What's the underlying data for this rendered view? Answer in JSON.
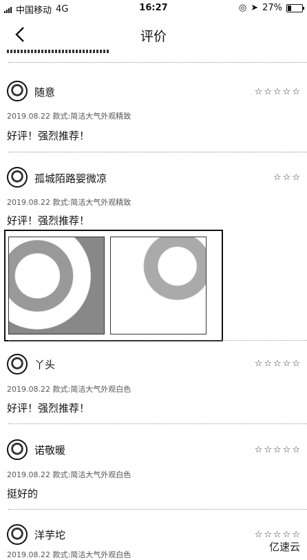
{
  "status_bar": {
    "carrier": "中国移动",
    "network": "4G",
    "time": "16:27",
    "battery_percent": "27%",
    "battery_level": 0.27
  },
  "nav": {
    "title": "评价",
    "back_icon": "chevron-left-icon"
  },
  "reviews": [
    {
      "name": "随意",
      "stars": "☆☆☆☆☆",
      "date": "2019.08.22",
      "variant": "款式:简洁大气外观精致",
      "text": "好评！强烈推荐！"
    },
    {
      "name": "孤城陌路婴微凉",
      "stars": "☆☆☆",
      "date": "2019.08.22",
      "variant": "款式:简洁大气外观精致",
      "text": "好评！强烈推荐！"
    },
    {
      "name": "丫头",
      "stars": "☆☆☆☆☆",
      "date": "2019.08.22",
      "variant": "款式:简洁大气外观白色",
      "text": "好评！强烈推荐！"
    },
    {
      "name": "诺敬暖",
      "stars": "☆☆☆☆☆",
      "date": "2019.08.22",
      "variant": "款式:简洁大气外观白色",
      "text": "挺好的"
    },
    {
      "name": "洋芋坨",
      "stars": "☆☆☆☆☆",
      "date": "2019.08.22",
      "variant": "款式:简洁大气外观白色",
      "text": ""
    }
  ],
  "watermark": "亿速云"
}
